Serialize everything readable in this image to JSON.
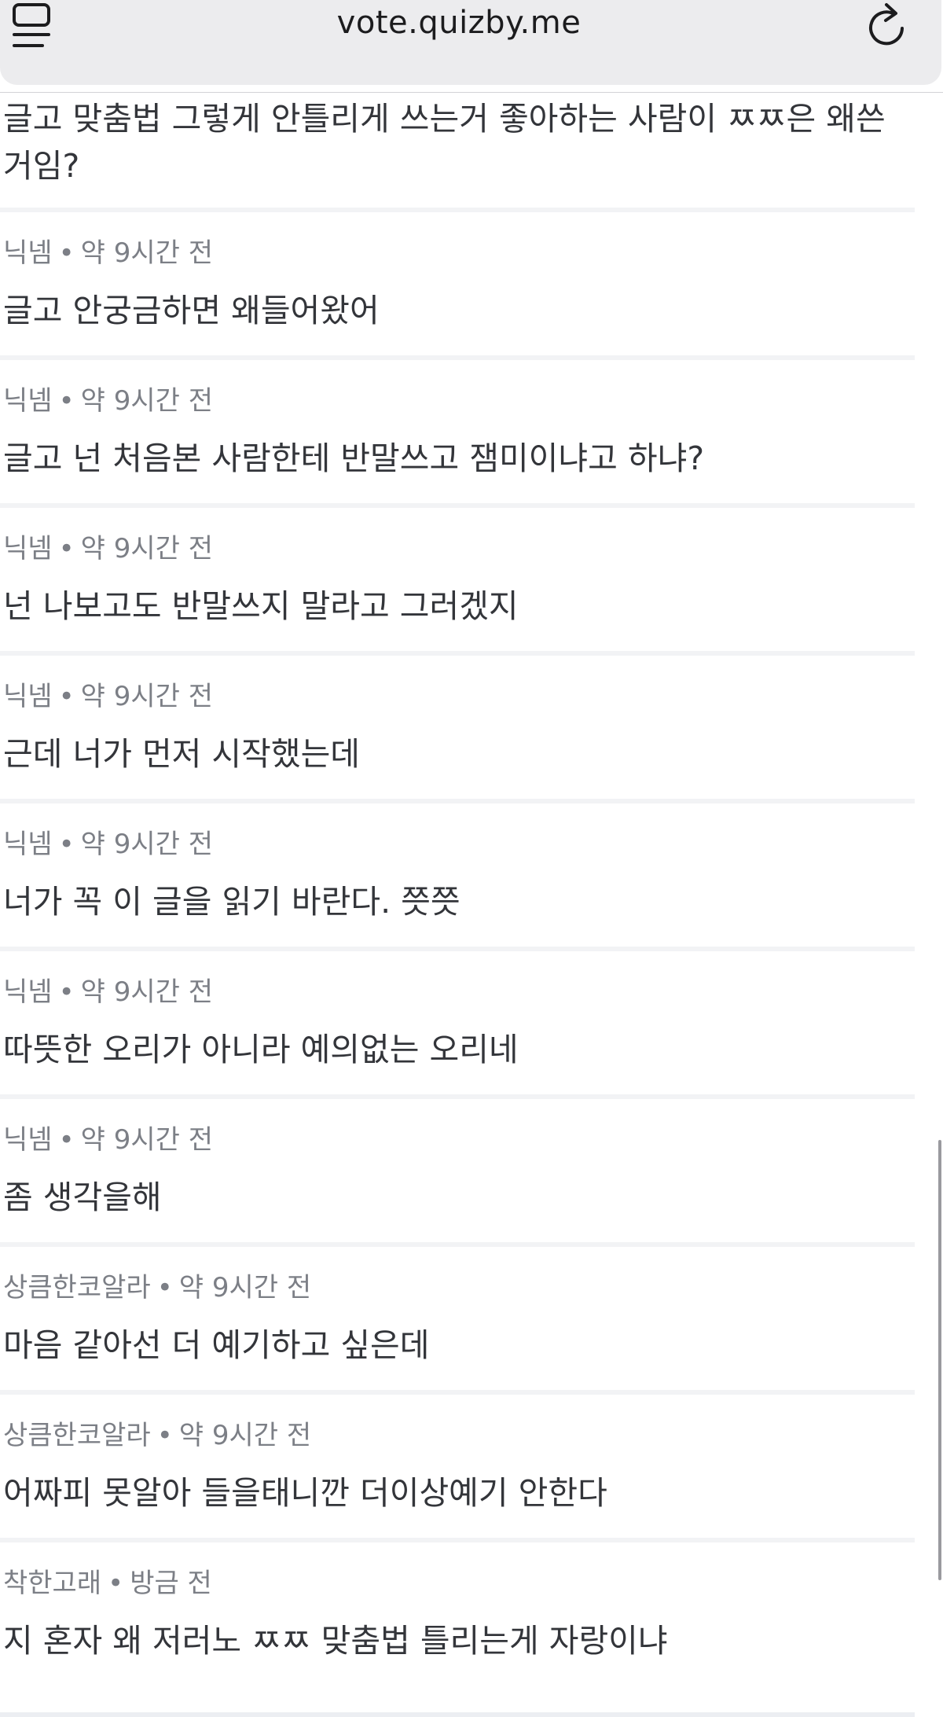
{
  "browser": {
    "url": "vote.quizby.me",
    "tabs_icon": "tabs-icon",
    "reload_icon": "reload-icon"
  },
  "first_comment": {
    "line1": "글고 맞춤법 그렇게 안틀리게 쓰는거 좋아하는 사람이 ㅉㅉ은 왜쓴",
    "line2": "거임?"
  },
  "comments": [
    {
      "author": "닉넴",
      "time": "약 9시간 전",
      "text": "글고 안궁금하면 왜들어왔어"
    },
    {
      "author": "닉넴",
      "time": "약 9시간 전",
      "text": "글고 넌 처음본 사람한테 반말쓰고 잼미이냐고 하냐?"
    },
    {
      "author": "닉넴",
      "time": "약 9시간 전",
      "text": "넌 나보고도 반말쓰지 말라고 그러겠지"
    },
    {
      "author": "닉넴",
      "time": "약 9시간 전",
      "text": "근데 너가 먼저 시작했는데"
    },
    {
      "author": "닉넴",
      "time": "약 9시간 전",
      "text": "너가 꼭 이 글을 읽기 바란다. 쯧쯧"
    },
    {
      "author": "닉넴",
      "time": "약 9시간 전",
      "text": "따뜻한 오리가 아니라 예의없는 오리네"
    },
    {
      "author": "닉넴",
      "time": "약 9시간 전",
      "text": "좀 생각을해"
    },
    {
      "author": "상큼한코알라",
      "time": "약 9시간 전",
      "text": "마음 같아선 더 예기하고 싶은데"
    },
    {
      "author": "상큼한코알라",
      "time": "약 9시간 전",
      "text": "어짜피 못알아 들을태니깐 더이상예기 안한다"
    },
    {
      "author": "착한고래",
      "time": "방금 전",
      "text": "지 혼자 왜 저러노 ㅉㅉ 맞춤법 틀리는게 자랑이냐"
    }
  ],
  "separator_dot": "•"
}
